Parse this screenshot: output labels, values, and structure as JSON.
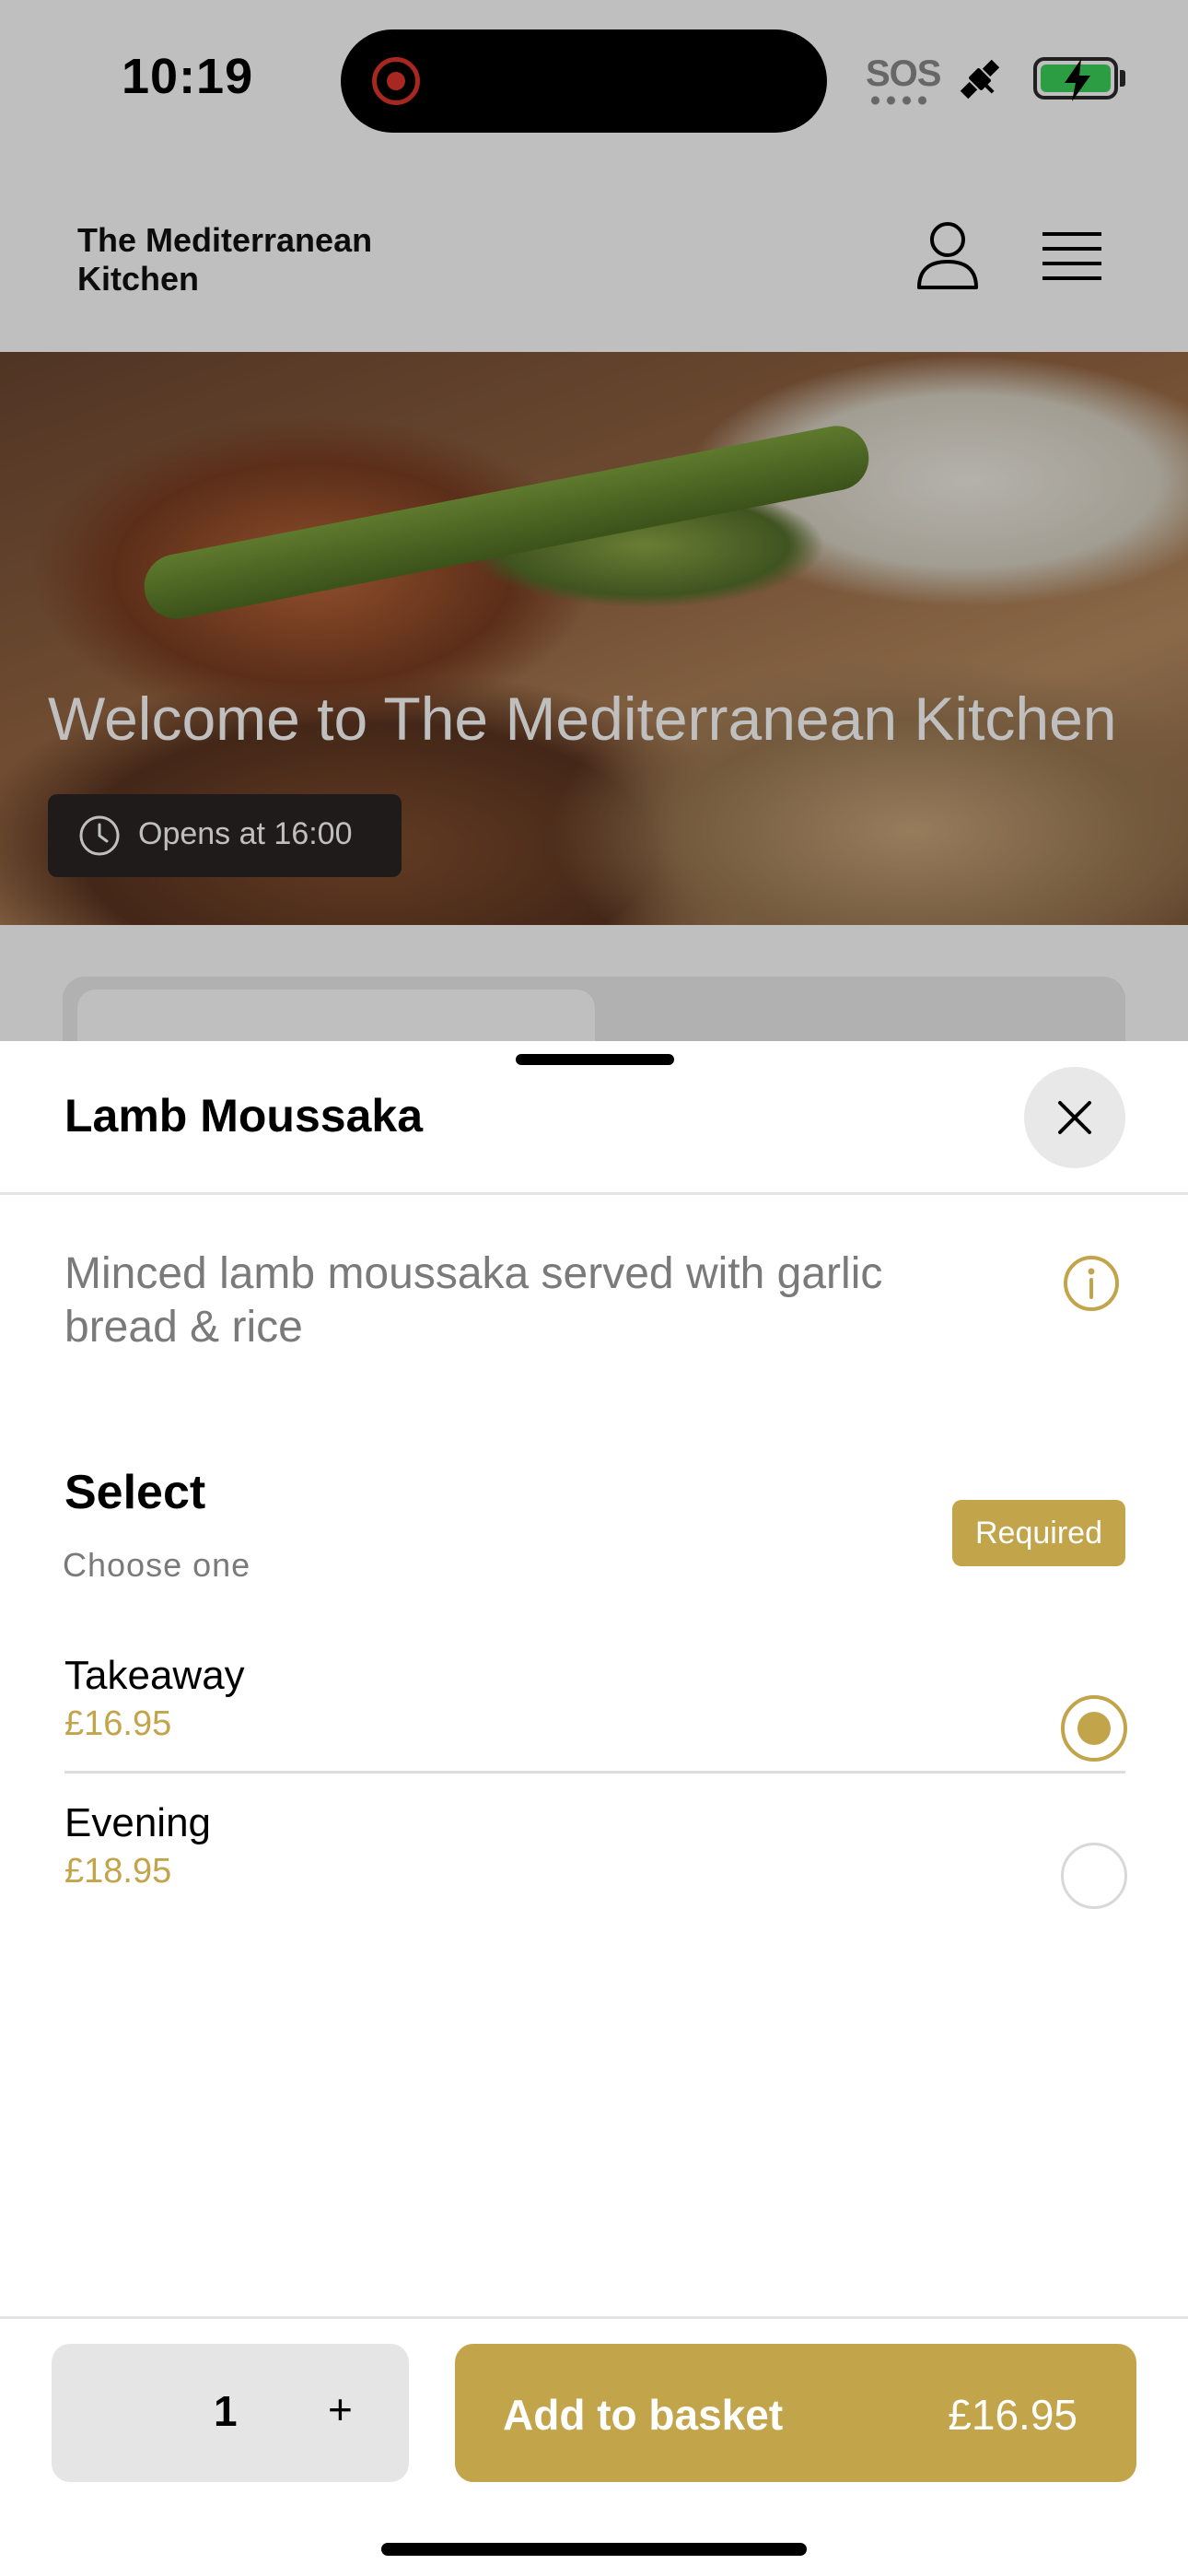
{
  "status_bar": {
    "time": "10:19",
    "sos": "SOS"
  },
  "header": {
    "brand": "The Mediterranean Kitchen",
    "icons": [
      "user-icon",
      "menu-icon"
    ]
  },
  "hero": {
    "title": "Welcome to The Mediterranean Kitchen",
    "hours": "Opens at 16:00"
  },
  "sheet": {
    "title": "Lamb Moussaka",
    "description": "Minced lamb moussaka served with garlic bread & rice",
    "section": {
      "title": "Select",
      "subtitle": "Choose one",
      "badge": "Required"
    },
    "options": [
      {
        "name": "Takeaway",
        "price": "£16.95",
        "selected": true
      },
      {
        "name": "Evening",
        "price": "£18.95",
        "selected": false
      }
    ],
    "footer": {
      "quantity": "1",
      "plus": "+",
      "add_label": "Add to basket",
      "add_price": "£16.95"
    }
  },
  "colors": {
    "accent": "#c2a44a",
    "overlay": "rgba(0,0,0,0.25)"
  }
}
